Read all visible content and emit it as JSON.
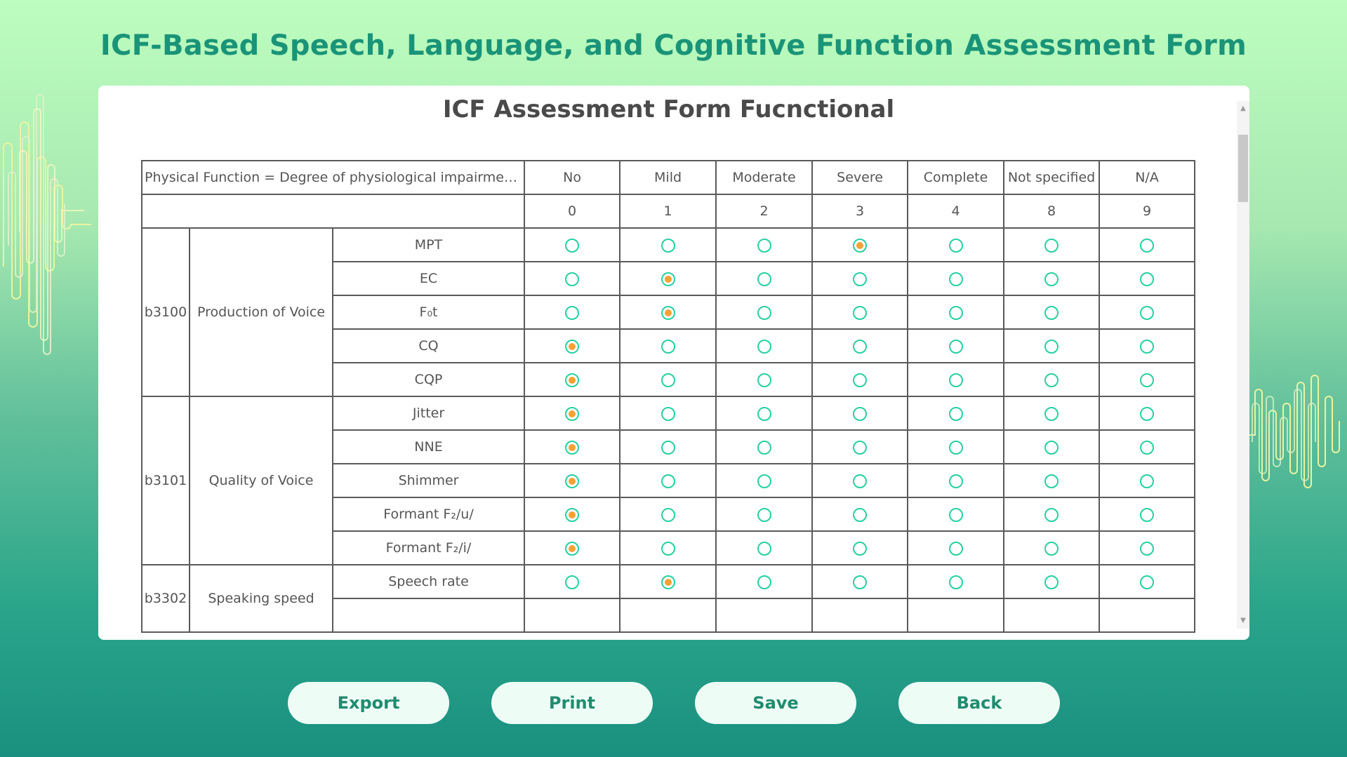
{
  "page_title": "ICF-Based Speech, Language, and Cognitive Function Assessment Form",
  "card_title": "ICF Assessment Form Fucnctional",
  "table": {
    "header_label": "Physical Function = Degree of physiological impairment of t...",
    "rating_labels": [
      "No",
      "Mild",
      "Moderate",
      "Severe",
      "Complete",
      "Not specified",
      "N/A"
    ],
    "rating_codes": [
      "0",
      "1",
      "2",
      "3",
      "4",
      "8",
      "9"
    ],
    "groups": [
      {
        "code": "b3100",
        "name": "Production of Voice",
        "rows": [
          {
            "label": "MPT",
            "selected": 3
          },
          {
            "label": "EC",
            "selected": 1
          },
          {
            "label": "F₀t",
            "selected": 1
          },
          {
            "label": "CQ",
            "selected": 0
          },
          {
            "label": "CQP",
            "selected": 0
          }
        ]
      },
      {
        "code": "b3101",
        "name": "Quality of Voice",
        "rows": [
          {
            "label": "Jitter",
            "selected": 0
          },
          {
            "label": "NNE",
            "selected": 0
          },
          {
            "label": "Shimmer",
            "selected": 0
          },
          {
            "label": "Formant F₂/u/",
            "selected": 0
          },
          {
            "label": "Formant F₂/i/",
            "selected": 0
          }
        ]
      },
      {
        "code": "b3302",
        "name": "Speaking speed",
        "rows": [
          {
            "label": "Speech rate",
            "selected": 1
          },
          {
            "label": "",
            "selected": -1
          }
        ]
      }
    ]
  },
  "buttons": {
    "export": "Export",
    "print": "Print",
    "save": "Save",
    "back": "Back"
  },
  "colors": {
    "title": "#1a9478",
    "radio_border": "#27d0a3",
    "radio_selected": "#f5a134",
    "button_text": "#1f8c6f"
  }
}
